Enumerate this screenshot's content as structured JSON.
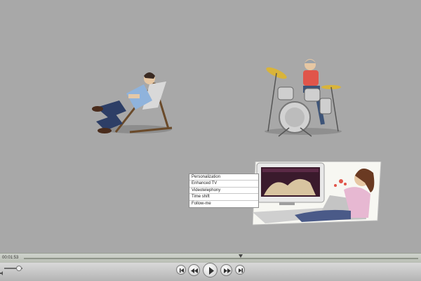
{
  "menu": {
    "items": [
      {
        "label": "Personalization"
      },
      {
        "label": "Enhanced TV"
      },
      {
        "label": "Videotelephony"
      },
      {
        "label": "Time shift"
      },
      {
        "label": "Follow-me"
      }
    ]
  },
  "player": {
    "time": "00:01:53",
    "controls": {
      "skip_back_icon": "skip-back-icon",
      "rewind_icon": "rewind-icon",
      "play_icon": "play-icon",
      "fast_forward_icon": "fast-forward-icon",
      "skip_forward_icon": "skip-forward-icon"
    },
    "playhead_progress": 0.55,
    "volume_level": 0.8
  },
  "colors": {
    "stage": "#a8a8a8",
    "control_bar": "#c6c6c6",
    "shirt_blue": "#8fb3dc",
    "shirt_red": "#e0554a",
    "cymbal": "#d9b43a"
  }
}
